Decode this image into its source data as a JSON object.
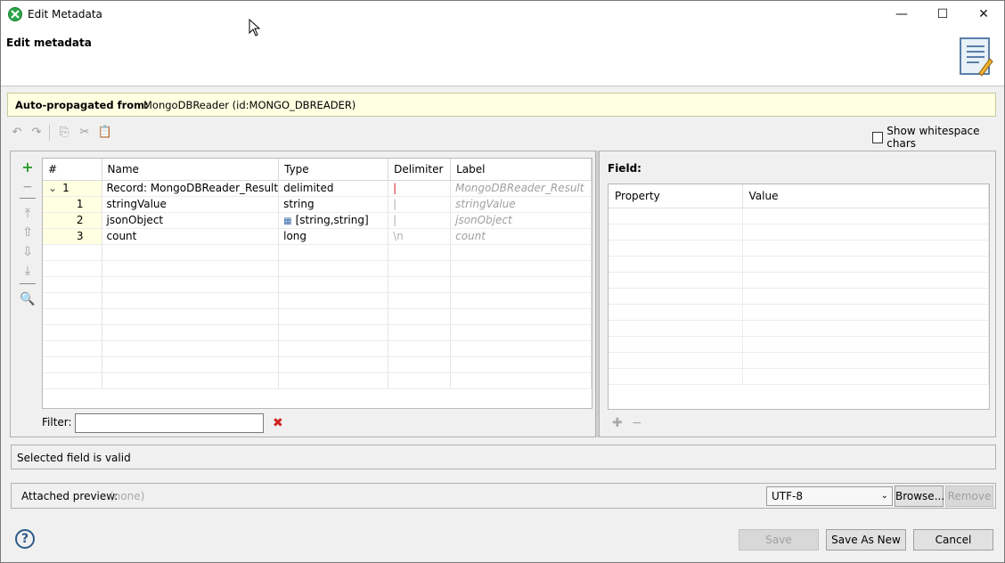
{
  "window": {
    "title": "Edit Metadata",
    "minimize": "—",
    "maximize": "☐",
    "close": "✕"
  },
  "header": {
    "title": "Edit metadata"
  },
  "autoprop": {
    "label": "Auto-propagated from:",
    "value": "MongoDBReader (id:MONGO_DBREADER)"
  },
  "toolbar": {
    "show_whitespace": "Show whitespace chars",
    "show_whitespace_checked": false
  },
  "grid": {
    "columns": [
      "#",
      "Name",
      "Type",
      "Delimiter",
      "Label"
    ],
    "rows": [
      {
        "num": "1",
        "name": "Record: MongoDBReader_Result",
        "type": "delimited",
        "delimiter": "|",
        "label": "MongoDBReader_Result",
        "record": true
      },
      {
        "num": "1",
        "name": "stringValue",
        "type": "string",
        "delimiter": "|",
        "label": "stringValue"
      },
      {
        "num": "2",
        "name": "jsonObject",
        "type": "[string,string]",
        "delimiter": "|",
        "label": "jsonObject"
      },
      {
        "num": "3",
        "name": "count",
        "type": "long",
        "delimiter": "\\n",
        "label": "count"
      }
    ]
  },
  "filter": {
    "label": "Filter:",
    "value": ""
  },
  "field_panel": {
    "title": "Field:",
    "columns": [
      "Property",
      "Value"
    ]
  },
  "status": {
    "text": "Selected field is valid"
  },
  "attached": {
    "label": "Attached preview:",
    "value": "(none)",
    "encoding": "UTF-8",
    "browse": "Browse...",
    "remove": "Remove"
  },
  "footer": {
    "help": "?",
    "save": "Save",
    "save_as_new": "Save As New",
    "cancel": "Cancel"
  }
}
